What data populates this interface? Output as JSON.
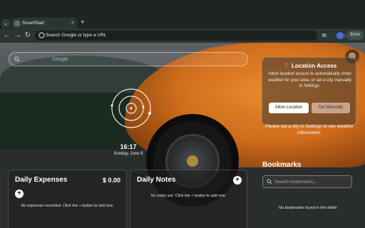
{
  "browser": {
    "tab_title": "SmartStart",
    "tab_close": "×",
    "new_tab": "+",
    "tab_list": "⌄",
    "back": "←",
    "forward": "→",
    "reload": "↻",
    "omnibox_placeholder": "Search Google or type a URL",
    "bookmark_star": "☆",
    "extensions": "⧉",
    "status_pill": "Error"
  },
  "page": {
    "search_placeholder": "Google",
    "settings_icon": "⚙",
    "clock": {
      "time": "16:17",
      "date": "Sunday, June 8"
    },
    "location": {
      "title": "📍 Location Access",
      "body": "Allow location access to automatically show weather for your area, or set a city manually in Settings.",
      "allow_button": "Allow Location",
      "manual_button": "Set Manually",
      "note": "Please set a city in Settings to see weather information."
    },
    "expenses": {
      "title": "Daily Expenses",
      "total": "$ 0.00",
      "add": "+",
      "empty": "No expenses recorded. Click the + button to add one."
    },
    "notes": {
      "title": "Daily Notes",
      "add": "+",
      "empty": "No notes yet. Click the + button to add one."
    },
    "bookmarks": {
      "title": "Bookmarks",
      "search_placeholder": "Search bookmarks...",
      "empty": "No bookmarks found in this folder"
    }
  },
  "colors": {
    "accent_orange": "#d8701a",
    "chrome_dark": "#1d2422",
    "toolbar": "#2b3532"
  }
}
